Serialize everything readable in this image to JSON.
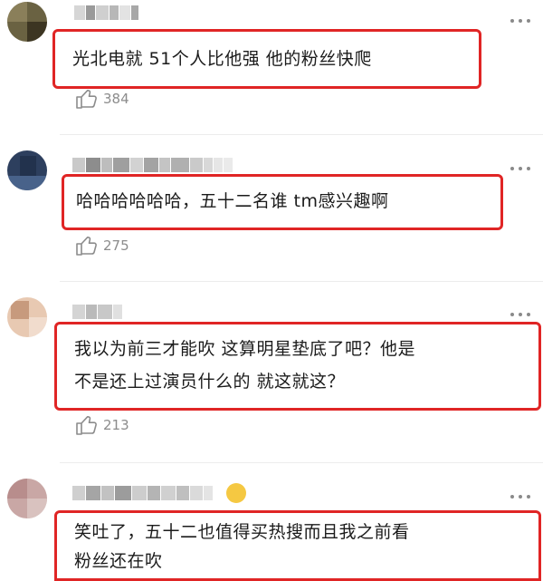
{
  "comments": [
    {
      "text": "光北电就 51个人比他强 他的粉丝快爬",
      "likes": "384"
    },
    {
      "text": "哈哈哈哈哈哈，五十二名谁 tm感兴趣啊",
      "likes": "275"
    },
    {
      "text_line1": "我以为前三才能吹 这算明星垫底了吧？他是",
      "text_line2": "不是还上过演员什么的 就这就这？",
      "likes": "213"
    },
    {
      "text_line1": "笑吐了，五十二也值得买热搜而且我之前看",
      "text_line2": "粉丝还在吹"
    }
  ],
  "colors": {
    "highlight": "#e02525",
    "meta": "#8c8c8c",
    "text": "#1b1b1b"
  },
  "icons": {
    "like": "thumbs-up-icon",
    "more": "more-dots-icon"
  }
}
